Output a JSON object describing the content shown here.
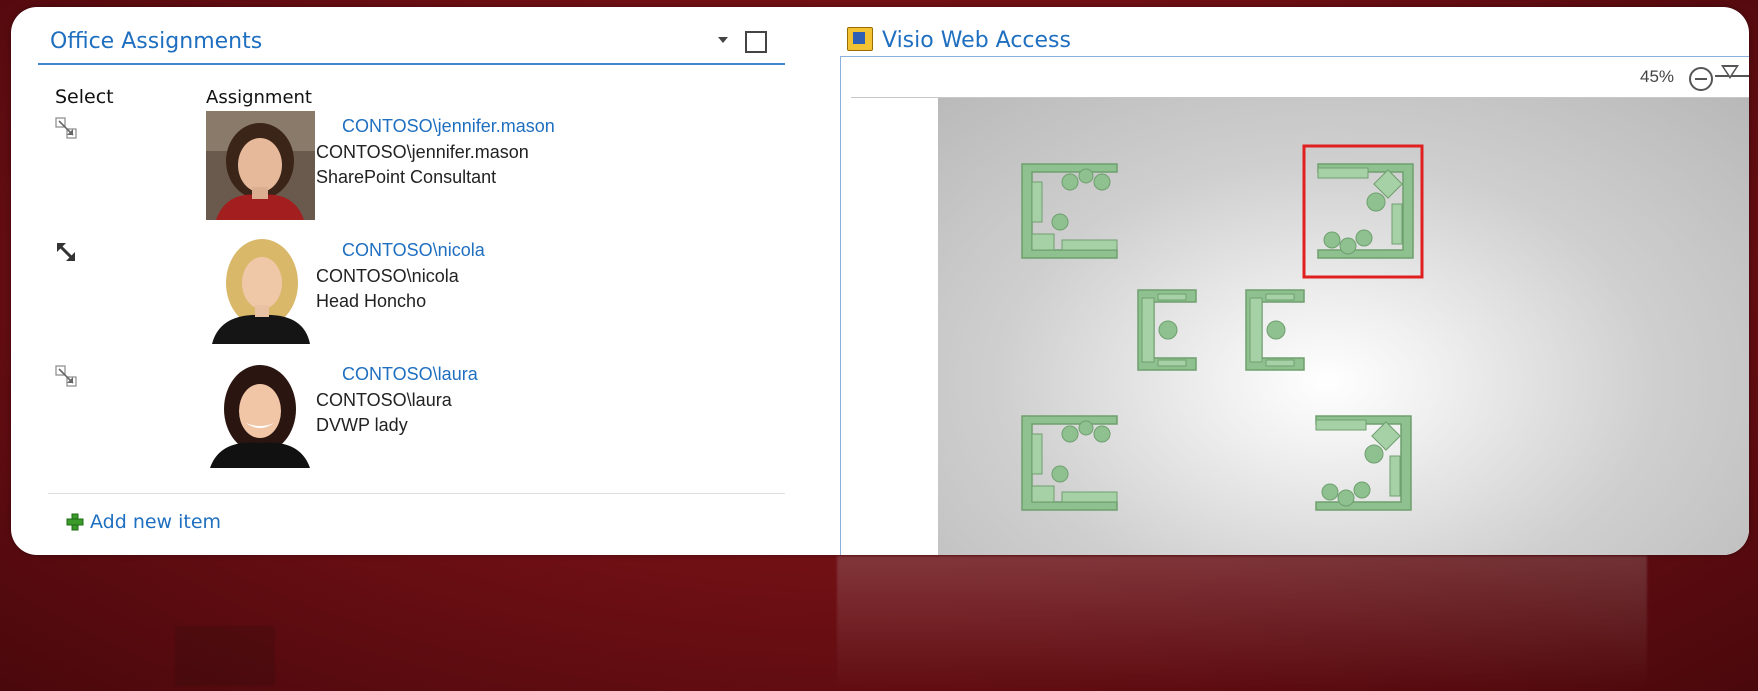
{
  "left_part": {
    "title": "Office Assignments",
    "columns": {
      "select": "Select",
      "assignment": "Assignment"
    },
    "rows": [
      {
        "link": "CONTOSO\\jennifer.mason",
        "account": "CONTOSO\\jennifer.mason",
        "role": "SharePoint Consultant",
        "selected": false
      },
      {
        "link": "CONTOSO\\nicola",
        "account": "CONTOSO\\nicola",
        "role": "Head Honcho",
        "selected": true
      },
      {
        "link": "CONTOSO\\laura",
        "account": "CONTOSO\\laura",
        "role": "DVWP lady",
        "selected": false
      }
    ],
    "add_new": "Add new item"
  },
  "right_part": {
    "title": "Visio Web Access",
    "zoom": "45%"
  },
  "colors": {
    "link": "#1f6fc0",
    "furniture": "#8fc08f",
    "highlight": "#e02020",
    "background": "#7a1217"
  }
}
